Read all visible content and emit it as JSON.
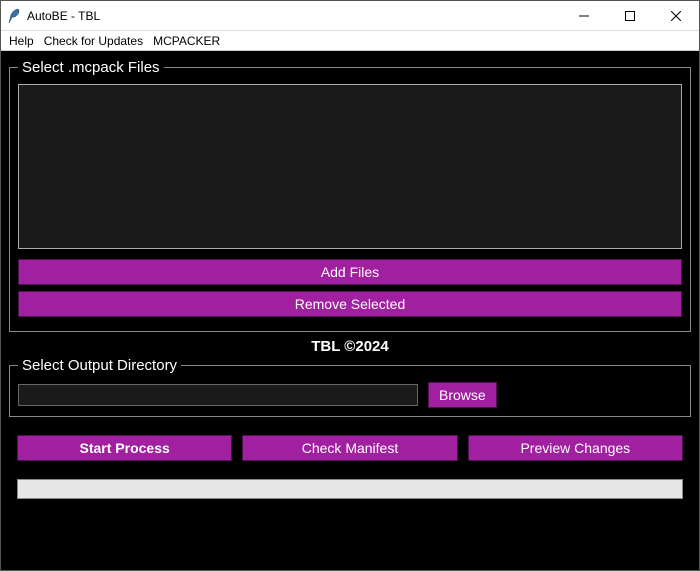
{
  "window": {
    "title": "AutoBE - TBL"
  },
  "menu": {
    "help": "Help",
    "updates": "Check for Updates",
    "mcpacker": "MCPACKER"
  },
  "files_group": {
    "legend": "Select .mcpack Files",
    "add_label": "Add Files",
    "remove_label": "Remove Selected"
  },
  "copyright": "TBL ©2024",
  "output_group": {
    "legend": "Select Output Directory",
    "path_value": "",
    "browse_label": "Browse"
  },
  "actions": {
    "start": "Start Process",
    "check": "Check Manifest",
    "preview": "Preview Changes"
  },
  "colors": {
    "accent": "#a020a0",
    "background": "#000000"
  }
}
